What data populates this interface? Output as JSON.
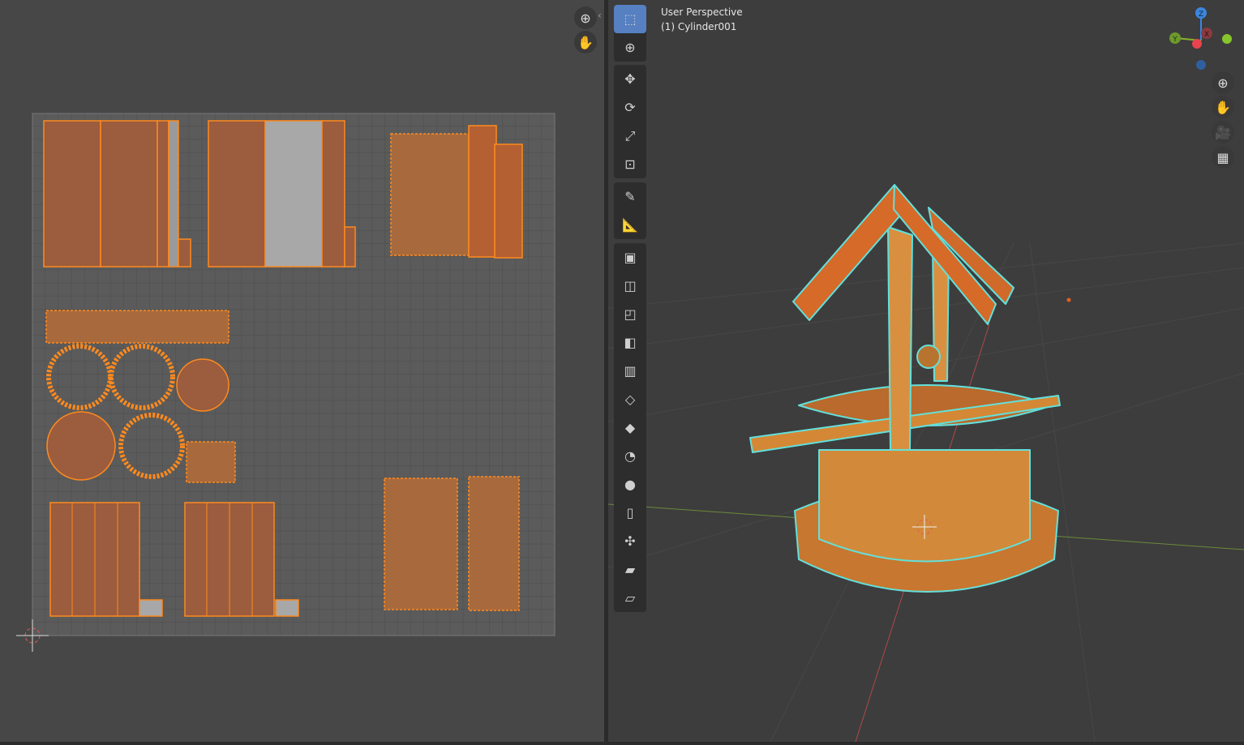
{
  "viewport": {
    "view_name": "User Perspective",
    "object_name": "(1) Cylinder001"
  },
  "gizmo": {
    "axes": [
      "Z",
      "Y",
      "X"
    ],
    "colors": {
      "x": "#e8434f",
      "y": "#86b32c",
      "z": "#3c86e0"
    }
  },
  "uv_editor": {
    "nav_icons": [
      "zoom-icon",
      "pan-hand-icon"
    ]
  },
  "viewport_nav": [
    "zoom-icon",
    "pan-hand-icon",
    "camera-icon",
    "perspective-grid-icon"
  ],
  "toolbar": {
    "tools": [
      "select-box",
      "cursor",
      "move",
      "rotate",
      "scale",
      "transform",
      "annotate",
      "measure",
      "add-cube",
      "extrude",
      "inset",
      "bevel",
      "loop-cut",
      "knife",
      "poly-build",
      "spin",
      "smooth",
      "edge-slide",
      "shrink-fatten",
      "shear"
    ]
  },
  "colors": {
    "selection": "#ff8a1e",
    "face": "#9c5c3e",
    "highlight": "#63e0dc"
  }
}
